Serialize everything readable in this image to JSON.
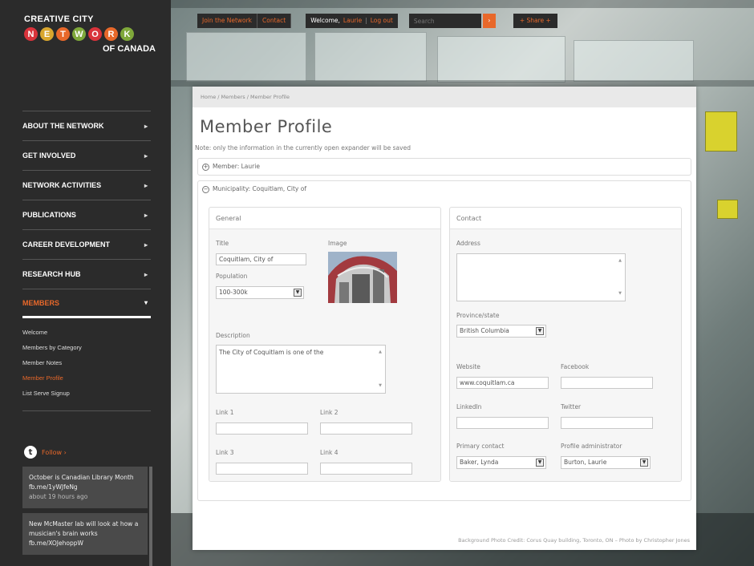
{
  "logo": {
    "line1": "CREATIVE CITY",
    "letters": [
      "N",
      "E",
      "T",
      "W",
      "O",
      "R",
      "K"
    ],
    "letter_colors": [
      "#d9333b",
      "#d9a62e",
      "#e8682a",
      "#7fa83a",
      "#d9333b",
      "#e8682a",
      "#7fa83a"
    ],
    "line3": "OF CANADA"
  },
  "nav": [
    {
      "label": "ABOUT THE NETWORK",
      "arrow": "▸"
    },
    {
      "label": "GET INVOLVED",
      "arrow": "▸"
    },
    {
      "label": "NETWORK ACTIVITIES",
      "arrow": "▸"
    },
    {
      "label": "PUBLICATIONS",
      "arrow": "▸"
    },
    {
      "label": "CAREER DEVELOPMENT",
      "arrow": "▸"
    },
    {
      "label": "RESEARCH HUB",
      "arrow": "▸"
    },
    {
      "label": "MEMBERS",
      "arrow": "▾"
    }
  ],
  "subnav": [
    "Welcome",
    "Members by Category",
    "Member Notes",
    "Member Profile",
    "List Serve Signup"
  ],
  "follow": {
    "icon": "t",
    "label": "Follow ›"
  },
  "tweets": [
    {
      "text": "October is Canadian Library Month fb.me/1yWJfeNg",
      "time": "about 19 hours ago"
    },
    {
      "text": "New McMaster lab will look at how a musician's brain works fb.me/XOJehoppW",
      "time": ""
    }
  ],
  "topbar": {
    "join": "Join the Network",
    "contact": "Contact",
    "welcome": "Welcome,",
    "user": "Laurie",
    "sep": "|",
    "logout": "Log out",
    "search_placeholder": "Search",
    "go": "›",
    "share": "+ Share +"
  },
  "breadcrumb": "Home / Members / Member Profile",
  "page_title": "Member Profile",
  "note": "Note: only the information in the currently open expander will be saved",
  "expander_member": {
    "icon": "+",
    "label": "Member: Laurie"
  },
  "expander_muni": {
    "icon": "−",
    "label": "Municipality: Coquitlam, City of"
  },
  "general": {
    "heading": "General",
    "title_label": "Title",
    "title_value": "Coquitlam, City of",
    "image_label": "Image",
    "population_label": "Population",
    "population_value": "100-300k",
    "description_label": "Description",
    "description_value": "The City of Coquitlam is one of the",
    "link1_label": "Link 1",
    "link2_label": "Link 2",
    "link3_label": "Link 3",
    "link4_label": "Link 4"
  },
  "contact": {
    "heading": "Contact",
    "address_label": "Address",
    "province_label": "Province/state",
    "province_value": "British Columbia",
    "website_label": "Website",
    "website_value": "www.coquitlam.ca",
    "facebook_label": "Facebook",
    "linkedin_label": "LinkedIn",
    "twitter_label": "Twitter",
    "primary_label": "Primary contact",
    "primary_value": "Baker, Lynda",
    "admin_label": "Profile administrator",
    "admin_value": "Burton, Laurie"
  },
  "caret": "▼",
  "footer": "Background Photo Credit: Corus Quay building, Toronto, ON – Photo by Christopher Jones"
}
